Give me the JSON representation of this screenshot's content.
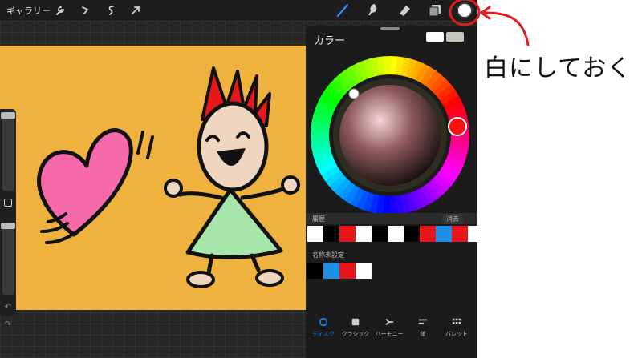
{
  "toolbar": {
    "gallery_label": "ギャラリー",
    "left_icons": [
      "wrench-icon",
      "magic-wand-icon",
      "selection-icon",
      "transform-arrow-icon"
    ],
    "right_icons": [
      "brush-icon",
      "smudge-icon",
      "eraser-icon",
      "layers-icon",
      "color-icon"
    ],
    "current_color": "#ffffff"
  },
  "canvas": {
    "background_color": "#efb23e"
  },
  "color_panel": {
    "title": "カラー",
    "current_swatch": "#ffffff",
    "previous_swatch": "#c7c7b9",
    "history_label": "履歴",
    "clear_label": "消去",
    "history_swatches": [
      "#ffffff",
      "#000000",
      "#e8151b",
      "#ffffff",
      "#000000",
      "#ffffff",
      "#000000",
      "#e8151b",
      "#1e8fe6",
      "#e8151b",
      "#ffffff"
    ],
    "palette_label": "名称未設定",
    "palette_swatches": [
      "#000000",
      "#1e8fe6",
      "#e8151b",
      "#ffffff"
    ],
    "tabs": [
      {
        "label": "ディスク",
        "icon": "disc-icon",
        "active": true
      },
      {
        "label": "クラシック",
        "icon": "classic-icon",
        "active": false
      },
      {
        "label": "ハーモニー",
        "icon": "harmony-icon",
        "active": false
      },
      {
        "label": "値",
        "icon": "value-icon",
        "active": false
      },
      {
        "label": "パレット",
        "icon": "palette-icon",
        "active": false
      }
    ]
  },
  "annotation": {
    "text": "白にしておく",
    "color": "#e51a1a"
  }
}
